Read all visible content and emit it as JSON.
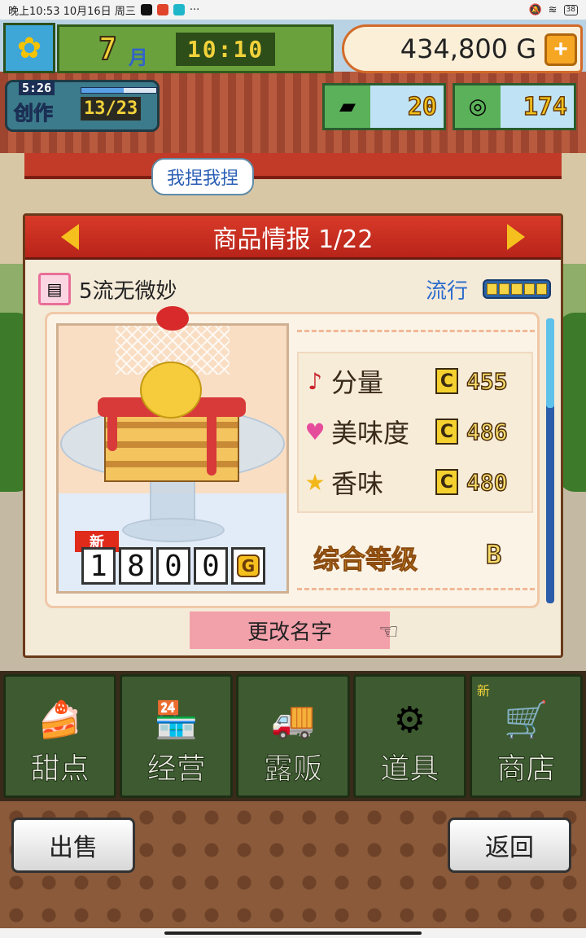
{
  "status_bar": {
    "time_date": "晚上10:53 10月16日 周三",
    "more": "···",
    "battery": "38"
  },
  "hud": {
    "month": "7",
    "month_unit": "月",
    "clock": "10:10",
    "money": "434,800 G",
    "plus_label": "+",
    "create_timer": "5:26",
    "create_label": "创作",
    "create_count": "13/23",
    "create_progress": 0.57,
    "gold_bars": "20",
    "medals": "174"
  },
  "speech_bubble": "我捏我捏",
  "panel": {
    "title": "商品情报 1/22",
    "item_name": "5流无微妙",
    "trend_label": "流行",
    "trend_level": 5,
    "new_tag": "新",
    "price_digits": [
      "1",
      "8",
      "0",
      "0"
    ],
    "price_unit": "G",
    "stats": [
      {
        "icon": "♪",
        "icon_name": "music-note-icon",
        "label": "分量",
        "grade": "C",
        "value": "455",
        "color": "#c8242a"
      },
      {
        "icon": "♥",
        "icon_name": "heart-icon",
        "label": "美味度",
        "grade": "C",
        "value": "486",
        "color": "#e64c9c"
      },
      {
        "icon": "★",
        "icon_name": "star-icon",
        "label": "香味",
        "grade": "C",
        "value": "480",
        "color": "#f2b81a"
      }
    ],
    "overall_label": "综合等级",
    "overall_grade": "B",
    "rename_label": "更改名字"
  },
  "menu": [
    {
      "key": "dessert",
      "label": "甜点",
      "icon": "🍰",
      "is_new": false
    },
    {
      "key": "manage",
      "label": "经营",
      "icon": "🏪",
      "is_new": false
    },
    {
      "key": "stall",
      "label": "露贩",
      "icon": "🚚",
      "is_new": false
    },
    {
      "key": "items",
      "label": "道具",
      "icon": "⚙",
      "is_new": false
    },
    {
      "key": "shop",
      "label": "商店",
      "icon": "🛒",
      "is_new": true
    }
  ],
  "menu_new_label": "新",
  "footer": {
    "sell_label": "出售",
    "back_label": "返回"
  }
}
